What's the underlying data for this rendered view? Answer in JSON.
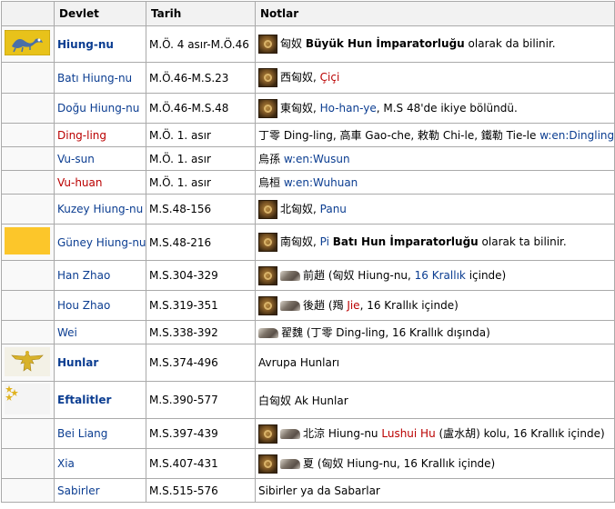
{
  "headers": {
    "devlet": "Devlet",
    "tarih": "Tarih",
    "notlar": "Notlar"
  },
  "rows": [
    {
      "name": "Hiung-nu",
      "date": "M.Ö. 4 asır-M.Ö.46",
      "n1": "匈奴 ",
      "n2": "Büyük Hun İmparatorluğu",
      "n3": " olarak da bilinir."
    },
    {
      "name": "Batı Hiung-nu",
      "date": "M.Ö.46-M.S.23",
      "n1": "西匈奴, ",
      "n2": "Çiçi"
    },
    {
      "name": "Doğu Hiung-nu",
      "date": "M.Ö.46-M.S.48",
      "n1": "東匈奴, ",
      "n2": "Ho-han-ye",
      "n3": ", M.S 48'de ikiye bölündü."
    },
    {
      "name": "Ding-ling",
      "date": "M.Ö. 1. asır",
      "n1": "丁零 Ding-ling, 高車 Gao-che, 敕勒 Chi-le, 鐵勒 Tie-le ",
      "n2": "w:en:Dingling"
    },
    {
      "name": "Vu-sun",
      "date": "M.Ö. 1. asır",
      "n1": "烏孫 ",
      "n2": "w:en:Wusun"
    },
    {
      "name": "Vu-huan",
      "date": "M.Ö. 1. asır",
      "n1": "烏桓 ",
      "n2": "w:en:Wuhuan"
    },
    {
      "name": "Kuzey Hiung-nu",
      "date": "M.S.48-156",
      "n1": "北匈奴, ",
      "n2": "Panu"
    },
    {
      "name": "Güney Hiung-nu",
      "date": "M.S.48-216",
      "n1": "南匈奴, ",
      "n2": "Pi",
      "n3": "Batı Hun İmparatorluğu",
      "n4": " olarak ta bilinir."
    },
    {
      "name": "Han Zhao",
      "date": "M.S.304-329",
      "n1": "前趙 (匈奴 Hiung-nu, ",
      "n2": "16 Krallık",
      "n3": " içinde)"
    },
    {
      "name": "Hou Zhao",
      "date": "M.S.319-351",
      "n1": "後趙 (羯 ",
      "n2": "Jie",
      "n3": ", 16 Krallık içinde)"
    },
    {
      "name": "Wei",
      "date": "M.S.338-392",
      "n1": "翟魏 (丁零 Ding-ling, 16 Krallık dışında)"
    },
    {
      "name": "Hunlar",
      "date": "M.S.374-496",
      "n1": "Avrupa Hunları"
    },
    {
      "name": "Eftalitler",
      "date": "M.S.390-577",
      "n1": "白匈奴 Ak Hunlar"
    },
    {
      "name": "Bei Liang",
      "date": "M.S.397-439",
      "n1": "北涼 Hiung-nu ",
      "n2": "Lushui Hu",
      "n3": " (盧水胡) kolu, 16 Krallık içinde)"
    },
    {
      "name": "Xia",
      "date": "M.S.407-431",
      "n1": "夏 (匈奴 Hiung-nu, 16 Krallık içinde)"
    },
    {
      "name": "Sabirler",
      "date": "M.S.515-576",
      "n1": "Sibirler ya da Sabarlar"
    }
  ]
}
